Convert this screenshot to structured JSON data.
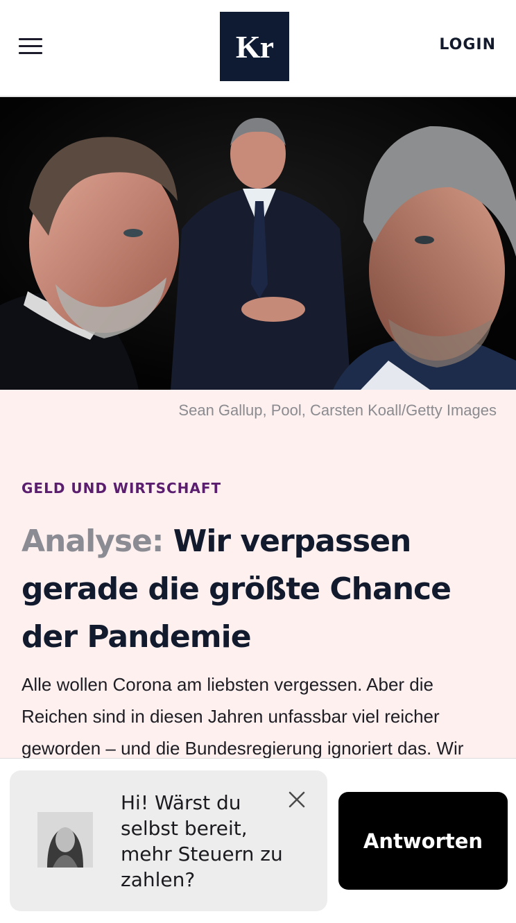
{
  "header": {
    "logo_text": "Kr",
    "login_label": "LOGIN",
    "icons": {
      "menu": "hamburger-menu-icon"
    }
  },
  "hero": {
    "image": "photo of three politicians against a dark background",
    "credit": "Sean Gallup, Pool, Carsten Koall/Getty Images"
  },
  "article": {
    "category": "GELD UND WIRTSCHAFT",
    "title_prefix": "Analyse:",
    "title": "Wir verpassen gerade die größte Chance der Pandemie",
    "lead": "Alle wollen Corona am liebsten vergessen. Aber die Reichen sind in diesen Jahren unfassbar viel reicher geworden – und die Bundesregierung ignoriert das. Wir"
  },
  "prompt": {
    "question": "Hi! Wärst du selbst bereit, mehr Steuern zu zahlen?",
    "answer_label": "Antworten",
    "icons": {
      "close": "close-icon",
      "avatar": "author-avatar"
    }
  },
  "colors": {
    "brand_navy": "#0f1a33",
    "category_purple": "#5b1d6e",
    "article_background": "#fdf0ef",
    "title_prefix_gray": "#8b8b93",
    "button_black": "#000000"
  }
}
